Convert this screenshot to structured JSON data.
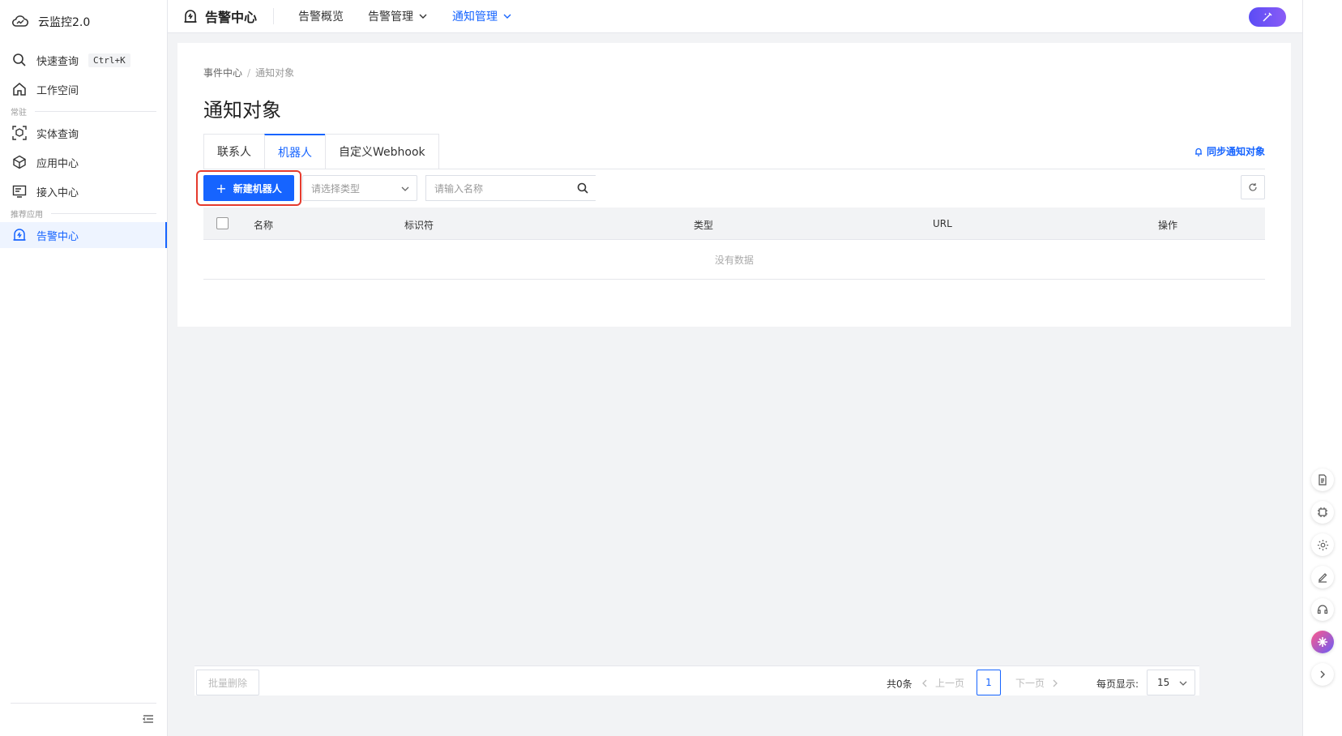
{
  "sidebar": {
    "brand": "云监控2.0",
    "quick_search": {
      "label": "快速查询",
      "shortcut": "Ctrl+K"
    },
    "workspace": "工作空间",
    "section_common": "常驻",
    "entity_query": "实体查询",
    "app_center": "应用中心",
    "access_center": "接入中心",
    "section_recommended": "推荐应用",
    "alert_center": "告警中心"
  },
  "header": {
    "title": "告警中心",
    "nav": [
      "告警概览",
      "告警管理",
      "通知管理"
    ]
  },
  "page": {
    "breadcrumb": [
      "事件中心",
      "通知对象"
    ],
    "title": "通知对象",
    "tabs": [
      "联系人",
      "机器人",
      "自定义Webhook"
    ],
    "active_tab": "机器人",
    "sync_link": "同步通知对象"
  },
  "toolbar": {
    "new_button": "新建机器人",
    "type_placeholder": "请选择类型",
    "search_placeholder": "请输入名称"
  },
  "table": {
    "columns": [
      "名称",
      "标识符",
      "类型",
      "URL",
      "操作"
    ],
    "empty_text": "没有数据"
  },
  "footer": {
    "batch_delete": "批量删除",
    "total": "共0条",
    "prev": "上一页",
    "page": "1",
    "next": "下一页",
    "per_page_label": "每页显示:",
    "per_page_value": "15"
  },
  "colors": {
    "primary": "#1664ff",
    "highlight_box": "#e53b2e"
  }
}
